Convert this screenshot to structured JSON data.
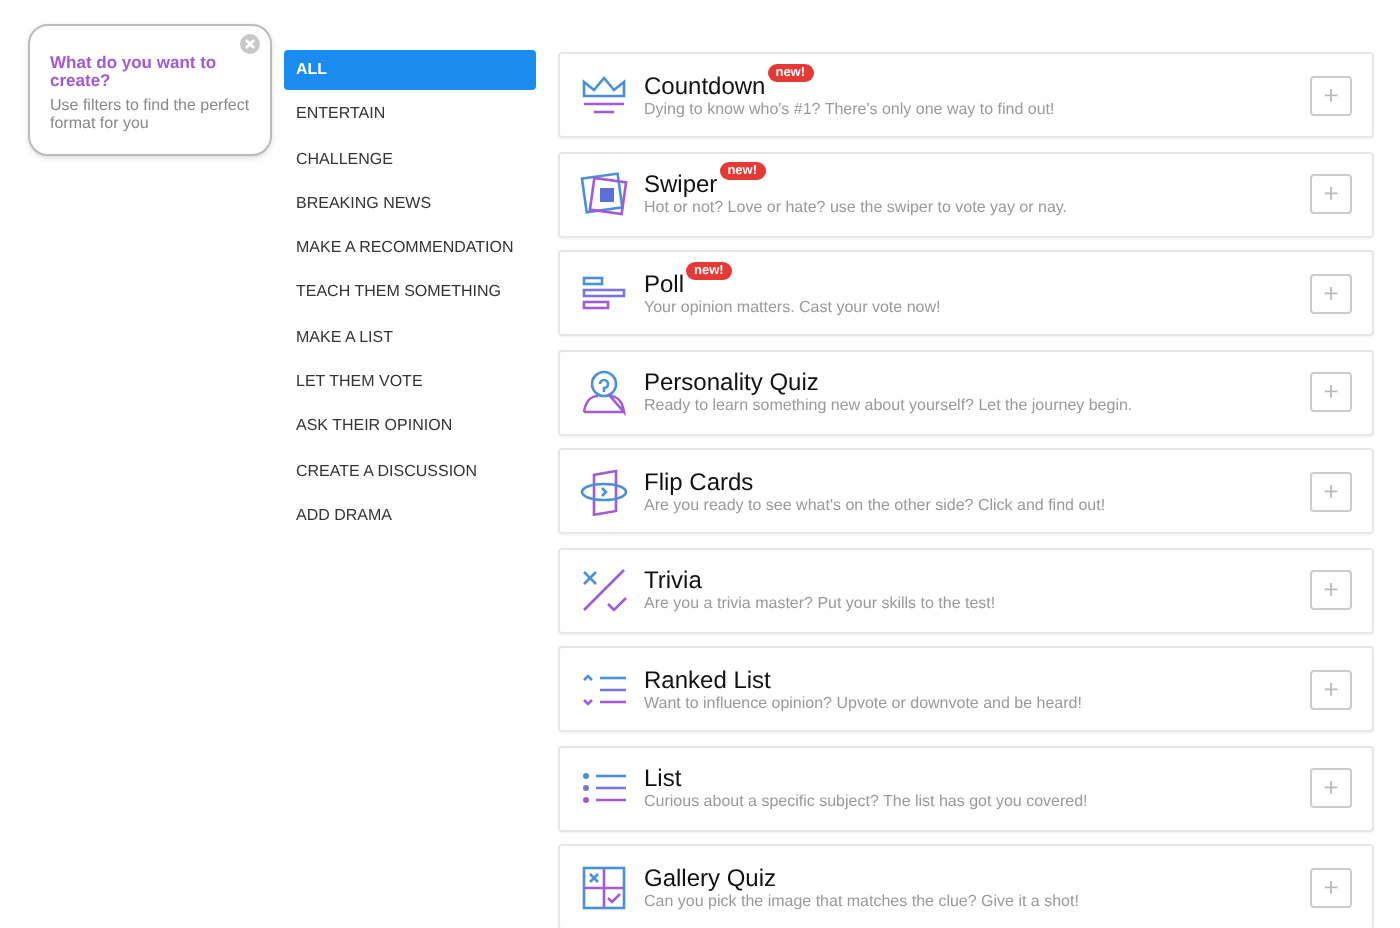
{
  "tooltip": {
    "title": "What do you want to create?",
    "text": "Use filters to find the perfect format for you"
  },
  "filters": [
    {
      "label": "ALL",
      "selected": true
    },
    {
      "label": "ENTERTAIN",
      "selected": false
    },
    {
      "label": "CHALLENGE",
      "selected": false
    },
    {
      "label": "BREAKING NEWS",
      "selected": false
    },
    {
      "label": "MAKE A RECOMMENDATION",
      "selected": false
    },
    {
      "label": "TEACH THEM SOMETHING",
      "selected": false
    },
    {
      "label": "MAKE A LIST",
      "selected": false
    },
    {
      "label": "LET THEM VOTE",
      "selected": false
    },
    {
      "label": "ASK THEIR OPINION",
      "selected": false
    },
    {
      "label": "CREATE A DISCUSSION",
      "selected": false
    },
    {
      "label": "ADD DRAMA",
      "selected": false
    }
  ],
  "formats": [
    {
      "kind": "countdown",
      "title": "Countdown",
      "badge": "new!",
      "description": "Dying to know who's #1? There's only one way to find out!",
      "button": "+"
    },
    {
      "kind": "swiper",
      "title": "Swiper",
      "badge": "new!",
      "description": "Hot or not? Love or hate? use the swiper to vote yay or nay.",
      "button": "+"
    },
    {
      "kind": "poll",
      "title": "Poll",
      "badge": "new!",
      "description": "Your opinion matters. Cast your vote now!",
      "button": "+"
    },
    {
      "kind": "personality",
      "title": "Personality Quiz",
      "description": "Ready to learn something new about yourself? Let the journey begin.",
      "button": "+"
    },
    {
      "kind": "flip",
      "title": "Flip Cards",
      "description": "Are you ready to see what's on the other side? Click and find out!",
      "button": "+"
    },
    {
      "kind": "trivia",
      "title": "Trivia",
      "description": "Are you a trivia master? Put your skills to the test!",
      "button": "+"
    },
    {
      "kind": "ranked",
      "title": "Ranked List",
      "description": "Want to influence opinion? Upvote or downvote and be heard!",
      "button": "+"
    },
    {
      "kind": "list",
      "title": "List",
      "description": "Curious about a specific subject? The list has got you covered!",
      "button": "+"
    },
    {
      "kind": "gallery",
      "title": "Gallery Quiz",
      "description": "Can you pick the image that matches the clue? Give it a shot!",
      "button": "+"
    }
  ]
}
